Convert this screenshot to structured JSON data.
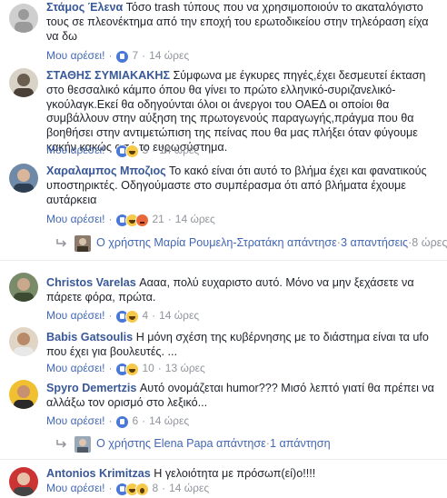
{
  "labels": {
    "like": "Μου αρέσει!",
    "reply": "Απάντηση",
    "sep": "·"
  },
  "colors": {
    "link": "#4267b2",
    "author": "#385898",
    "muted": "#90949c"
  },
  "comments": [
    {
      "author": "Στάμος Έλενα",
      "text": "Τόσο trash τύπους που να χρησιμοποιούν το ακαταλόγιστο τους σε πλεονέκτημα από την εποχή του ερωτοδικείου στην τηλεόραση είχα να δω",
      "reactions": [
        "like"
      ],
      "count": "7",
      "time": "14 ώρες"
    },
    {
      "author": "ΣΤΑΘΗΣ ΣΥΜΙΑΚΑΚΗΣ",
      "text": "Σύμφωνα με έγκυρες πηγές,έχει δεσμευτεί έκταση στο θεσσαλικό κάμπο όπου θα γίνει το πρώτο ελληνικό-συριζανελικό-γκούλαγκ.Εκεί θα οδηγούνται όλοι οι άνεργοι του ΟΑΕΔ οι οποίοι θα συμβάλλουν στην αύξηση της πρωτογενούς παραγωγής,πράγμα που θα βοηθήσει στην αντιμετώπιση της πείνας που θα μας πλήξει όταν φύγουμε κακήν κακώς από το ευρωσύστημα.",
      "reactions": [
        "like",
        "haha"
      ],
      "count": "5",
      "time": "14 ώρες"
    },
    {
      "author": "Χαραλαμπος Μποζιος",
      "text": "Το κακό είναι ότι αυτό το βλήμα έχει και φανατικούς υποστηρικτές. Οδηγούμαστε στο συμπέρασμα ότι από βλήματα έχουμε αυτάρκεια",
      "reactions": [
        "like",
        "haha",
        "angry"
      ],
      "count": "21",
      "time": "14 ώρες",
      "replies": {
        "user": "Ο χρήστης Μαρία Ρουμελη-Στρατάκη απάντησε",
        "count": "3 απαντήσεις",
        "time": "8 ώρες"
      }
    },
    {
      "author": "Christos Varelas",
      "text": "Αααα, πολύ ευχαριστο αυτό. Μόνο να μην ξεχάσετε να πάρετε φόρα, πρώτα.",
      "reactions": [
        "like",
        "haha"
      ],
      "count": "4",
      "time": "14 ώρες"
    },
    {
      "author": "Babis Gatsoulis",
      "text": "Η μόνη σχέση της κυβέρνησης με το διάστημα είναι τα ufo που έχει για βουλευτές. ...",
      "reactions": [
        "like",
        "haha"
      ],
      "count": "10",
      "time": "13 ώρες"
    },
    {
      "author": "Spyro Demertzis",
      "text": "Αυτό ονομάζεται humor??? Μισό λεπτό γιατί θα πρέπει να αλλάξω τον ορισμό στο λεξικό...",
      "reactions": [
        "like"
      ],
      "count": "6",
      "time": "14 ώρες",
      "replies": {
        "user": "Ο χρήστης Elena Papa απάντησε",
        "count": "1 απάντηση",
        "time": ""
      }
    },
    {
      "author": "Antonios Krimitzas",
      "text": "Η γελοιότητα με πρόσωπ(εί)ο!!!!",
      "reactions": [
        "like",
        "haha",
        "wow"
      ],
      "count": "8",
      "time": "14 ώρες"
    }
  ]
}
